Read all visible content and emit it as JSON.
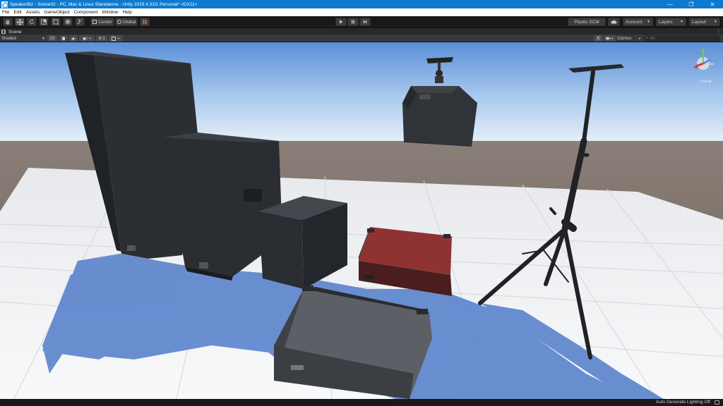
{
  "window": {
    "title": "SpeakerBiz - Scene02 - PC, Mac & Linux Standalone - Unity 2019.4.31f1 Personal* <DX11>",
    "minimize": "—",
    "maximize": "❐",
    "close": "✕"
  },
  "menu": [
    "File",
    "Edit",
    "Assets",
    "GameObject",
    "Component",
    "Window",
    "Help"
  ],
  "toolbar": {
    "pivot_label": "Center",
    "space_label": "Global",
    "plastic_label": "Plastic SCM",
    "account_label": "Account",
    "layers_label": "Layers",
    "layout_label": "Layout"
  },
  "scene_tab": {
    "label": "Scene"
  },
  "scene_toolbar": {
    "draw_mode": "Shaded",
    "mode_2d": "2D",
    "fx_count": "1",
    "gizmos_label": "Gizmos",
    "search_placeholder": "All"
  },
  "status": {
    "lighting": "Auto Generate Lighting Off"
  },
  "colors": {
    "title_bar": "#0e7acf",
    "sky_top": "#5b8fd6",
    "horizon": "#ddecf8",
    "ground_far": "#7d6e65",
    "floor": "#f4f5f7",
    "shadow": "#5a83cc",
    "red_case": "#8f3332"
  }
}
